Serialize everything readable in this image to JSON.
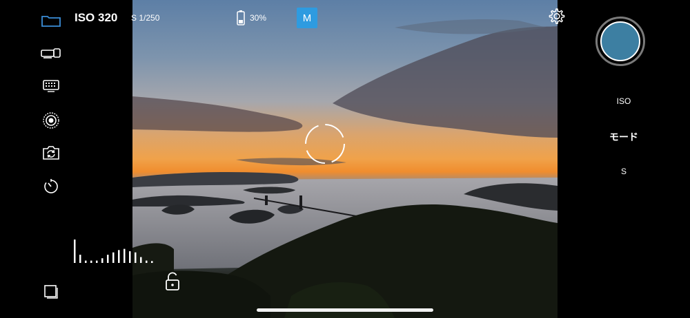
{
  "top_bar": {
    "iso": "ISO 320",
    "shutter": "S 1/250",
    "battery": "30%",
    "mode_badge": "M"
  },
  "right_panel": {
    "iso_label": "ISO",
    "mode_label": "モード",
    "s_label": "S"
  },
  "icons": {
    "left": [
      "folder-icon",
      "lens-icon",
      "keyboard-icon",
      "focus-target-icon",
      "switch-camera-icon",
      "timer-icon",
      "gallery-icon"
    ],
    "top": [
      "battery-icon",
      "settings-gear-icon"
    ],
    "overlay": [
      "focus-ring",
      "lock-icon"
    ]
  },
  "colors": {
    "mode_badge": "#2e9be0",
    "shutter_fill": "#3d7fa2",
    "shutter_ring": "#7a7a7a"
  },
  "audio_level": {
    "levels": [
      1.0,
      0.35,
      0.1,
      0.1,
      0.1,
      0.2,
      0.35,
      0.45,
      0.55,
      0.6,
      0.5,
      0.45,
      0.25,
      0.1,
      0.08
    ]
  }
}
